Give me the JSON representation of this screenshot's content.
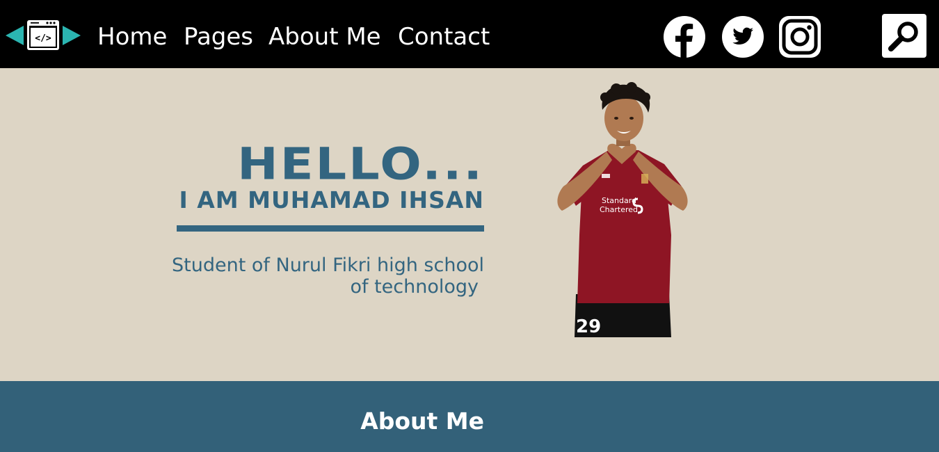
{
  "nav": {
    "logo_icon": "code-window-icon",
    "items": [
      {
        "label": "Home"
      },
      {
        "label": "Pages"
      },
      {
        "label": "About Me"
      },
      {
        "label": "Contact"
      }
    ],
    "social": [
      {
        "icon": "facebook-icon"
      },
      {
        "icon": "twitter-icon"
      },
      {
        "icon": "instagram-icon"
      }
    ],
    "search_icon": "search-icon"
  },
  "hero": {
    "greeting": "HELLO...",
    "name": "I AM MUHAMAD IHSAN",
    "subtitle_line1": "Student of Nurul Fikri high school",
    "subtitle_line2": "of technology",
    "photo_jersey_number": "29"
  },
  "about": {
    "title": "About Me"
  },
  "colors": {
    "nav_bg": "#000000",
    "hero_bg": "#ddd5c5",
    "accent": "#336580",
    "about_bg": "#336179",
    "logo_arrows": "#2bb5b1"
  }
}
